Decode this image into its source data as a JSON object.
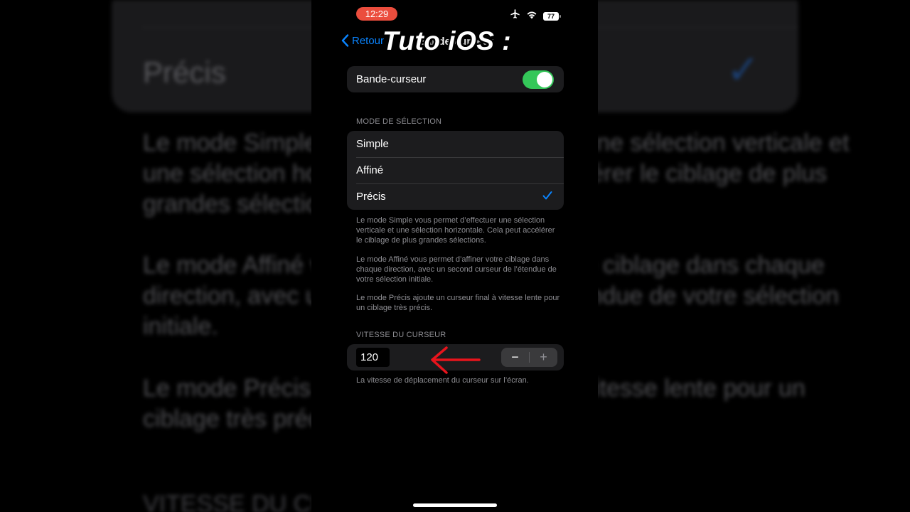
{
  "status_bar": {
    "time": "12:29",
    "battery": "77",
    "icons": [
      "airplane-icon",
      "wifi-icon",
      "battery-icon"
    ]
  },
  "nav": {
    "back_label": "Retour",
    "title": "Bande-curseur"
  },
  "overlay": {
    "caption": "Tuto iOS :"
  },
  "toggle_row": {
    "label": "Bande-curseur",
    "enabled": true
  },
  "selection_mode": {
    "header": "MODE DE SÉLECTION",
    "options": [
      {
        "label": "Simple",
        "selected": false
      },
      {
        "label": "Affiné",
        "selected": false
      },
      {
        "label": "Précis",
        "selected": true
      }
    ],
    "footer": [
      "Le mode Simple vous permet d’effectuer une sélection verticale et une sélection horizontale. Cela peut accélérer le ciblage de plus grandes sélections.",
      "Le mode Affiné vous permet d’affiner votre ciblage dans chaque direction, avec un second curseur de l’étendue de votre sélection initiale.",
      "Le mode Précis ajoute un curseur final à vitesse lente pour un ciblage très précis."
    ]
  },
  "cursor_speed": {
    "header": "VITESSE DU CURSEUR",
    "value": "120",
    "minus": "−",
    "plus": "+",
    "footer": "La vitesse de déplacement du curseur sur l’écran."
  },
  "background_zoom": {
    "label": "Précis",
    "para1": "Le mode Simple vous permet d’effectuer une sélection verticale et une sélection horizontale. Cela peut accélérer le ciblage de plus grandes sélections.",
    "para2": "Le mode Affiné vous permet d’affiner votre ciblage dans chaque direction, avec un second curseur de l’étendue de votre sélection initiale.",
    "para3": "Le mode Précis ajoute un curseur final à vitesse lente pour un ciblage très précis.",
    "header": "VITESSE DU CURSEUR"
  },
  "colors": {
    "accent": "#0a84ff",
    "toggle_on": "#34c759",
    "time_pill": "#eb4d3d",
    "arrow": "#e8141c"
  }
}
